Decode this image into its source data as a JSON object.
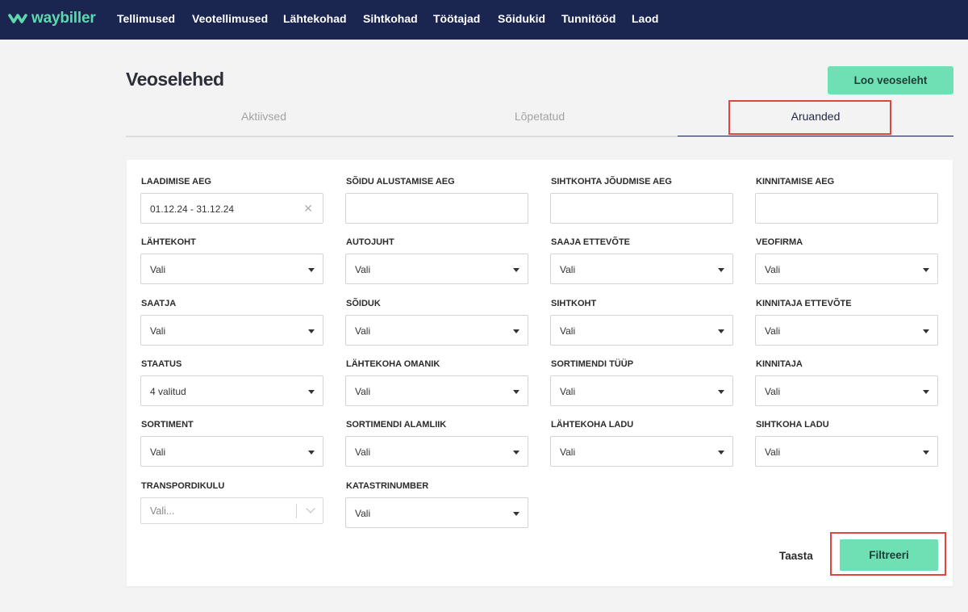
{
  "app": {
    "logo_text": "waybiller",
    "brand_color": "#5ed8ad",
    "nav_background": "#1a2550"
  },
  "nav": {
    "items": [
      "Tellimused",
      "Veotellimused",
      "Lähtekohad",
      "Sihtkohad",
      "Töötajad",
      "Sõidukid",
      "Tunnitööd",
      "Laod"
    ]
  },
  "header": {
    "title": "Veoselehed",
    "create_button": "Loo veoseleht"
  },
  "tabs": [
    {
      "label": "Aktiivsed",
      "active": false
    },
    {
      "label": "Lõpetatud",
      "active": false
    },
    {
      "label": "Aruanded",
      "active": true
    }
  ],
  "filters": {
    "loading_time": {
      "label": "LAADIMISE AEG",
      "value": "01.12.24 - 31.12.24",
      "clear_icon": "close-icon"
    },
    "trip_start_time": {
      "label": "SÕIDU ALUSTAMISE AEG",
      "value": ""
    },
    "arrival_time": {
      "label": "SIHTKOHTA JÕUDMISE AEG",
      "value": ""
    },
    "confirmation_time": {
      "label": "KINNITAMISE AEG",
      "value": ""
    },
    "origin": {
      "label": "LÄHTEKOHT",
      "value": "Vali"
    },
    "driver": {
      "label": "AUTOJUHT",
      "value": "Vali"
    },
    "receiver_company": {
      "label": "SAAJA ETTEVÕTE",
      "value": "Vali"
    },
    "carrier": {
      "label": "VEOFIRMA",
      "value": "Vali"
    },
    "sender": {
      "label": "SAATJA",
      "value": "Vali"
    },
    "vehicle": {
      "label": "SÕIDUK",
      "value": "Vali"
    },
    "destination": {
      "label": "SIHTKOHT",
      "value": "Vali"
    },
    "confirmer_company": {
      "label": "KINNITAJA ETTEVÕTE",
      "value": "Vali"
    },
    "status": {
      "label": "STAATUS",
      "value": "4 valitud"
    },
    "origin_owner": {
      "label": "LÄHTEKOHA OMANIK",
      "value": "Vali"
    },
    "assortment_type": {
      "label": "SORTIMENDI TÜÜP",
      "value": "Vali"
    },
    "confirmer": {
      "label": "KINNITAJA",
      "value": "Vali"
    },
    "assortment": {
      "label": "SORTIMENT",
      "value": "Vali"
    },
    "assortment_subtype": {
      "label": "SORTIMENDI ALAMLIIK",
      "value": "Vali"
    },
    "origin_warehouse": {
      "label": "LÄHTEKOHA LADU",
      "value": "Vali"
    },
    "destination_warehouse": {
      "label": "SIHTKOHA LADU",
      "value": "Vali"
    },
    "transport_cost": {
      "label": "TRANSPORDIKULU",
      "placeholder": "Vali..."
    },
    "cadastral_number": {
      "label": "KATASTRINUMBER",
      "value": "Vali"
    }
  },
  "actions": {
    "reset_label": "Taasta",
    "filter_label": "Filtreeri"
  },
  "highlight_color": "#e0463c",
  "accent_color": "#6ee0b4"
}
